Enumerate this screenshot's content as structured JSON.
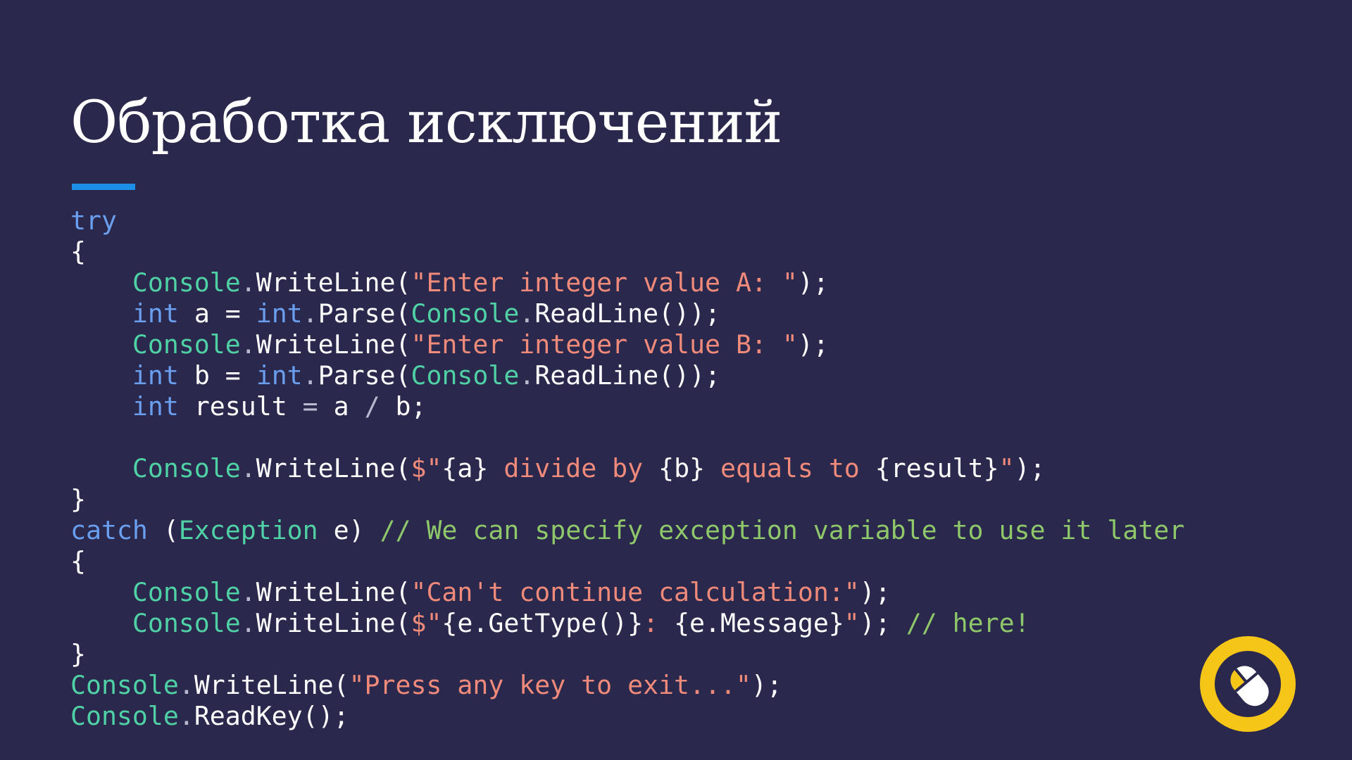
{
  "slide": {
    "title": "Обработка исключений"
  },
  "code": {
    "lines": [
      [
        {
          "t": "try",
          "c": "kw"
        }
      ],
      [
        {
          "t": "{",
          "c": "pl"
        }
      ],
      [
        {
          "t": "    ",
          "c": "pl"
        },
        {
          "t": "Console",
          "c": "ty"
        },
        {
          "t": ".",
          "c": "dim"
        },
        {
          "t": "WriteLine(",
          "c": "pl"
        },
        {
          "t": "\"Enter integer value A: \"",
          "c": "str"
        },
        {
          "t": ");",
          "c": "pl"
        }
      ],
      [
        {
          "t": "    ",
          "c": "pl"
        },
        {
          "t": "int",
          "c": "kw"
        },
        {
          "t": " a = ",
          "c": "pl"
        },
        {
          "t": "int",
          "c": "kw"
        },
        {
          "t": ".",
          "c": "dim"
        },
        {
          "t": "Parse(",
          "c": "pl"
        },
        {
          "t": "Console",
          "c": "ty"
        },
        {
          "t": ".",
          "c": "dim"
        },
        {
          "t": "ReadLine());",
          "c": "pl"
        }
      ],
      [
        {
          "t": "    ",
          "c": "pl"
        },
        {
          "t": "Console",
          "c": "ty"
        },
        {
          "t": ".",
          "c": "dim"
        },
        {
          "t": "WriteLine(",
          "c": "pl"
        },
        {
          "t": "\"Enter integer value B: \"",
          "c": "str"
        },
        {
          "t": ");",
          "c": "pl"
        }
      ],
      [
        {
          "t": "    ",
          "c": "pl"
        },
        {
          "t": "int",
          "c": "kw"
        },
        {
          "t": " b = ",
          "c": "pl"
        },
        {
          "t": "int",
          "c": "kw"
        },
        {
          "t": ".",
          "c": "dim"
        },
        {
          "t": "Parse(",
          "c": "pl"
        },
        {
          "t": "Console",
          "c": "ty"
        },
        {
          "t": ".",
          "c": "dim"
        },
        {
          "t": "ReadLine());",
          "c": "pl"
        }
      ],
      [
        {
          "t": "    ",
          "c": "pl"
        },
        {
          "t": "int",
          "c": "kw"
        },
        {
          "t": " result ",
          "c": "pl"
        },
        {
          "t": "=",
          "c": "dim"
        },
        {
          "t": " a ",
          "c": "pl"
        },
        {
          "t": "/",
          "c": "dim"
        },
        {
          "t": " b;",
          "c": "pl"
        }
      ],
      [
        {
          "t": "",
          "c": "pl"
        }
      ],
      [
        {
          "t": "    ",
          "c": "pl"
        },
        {
          "t": "Console",
          "c": "ty"
        },
        {
          "t": ".",
          "c": "dim"
        },
        {
          "t": "WriteLine(",
          "c": "pl"
        },
        {
          "t": "$\"",
          "c": "str"
        },
        {
          "t": "{a}",
          "c": "pl"
        },
        {
          "t": " divide by ",
          "c": "str"
        },
        {
          "t": "{b}",
          "c": "pl"
        },
        {
          "t": " equals to ",
          "c": "str"
        },
        {
          "t": "{result}",
          "c": "pl"
        },
        {
          "t": "\"",
          "c": "str"
        },
        {
          "t": ");",
          "c": "pl"
        }
      ],
      [
        {
          "t": "}",
          "c": "pl"
        }
      ],
      [
        {
          "t": "catch",
          "c": "kw"
        },
        {
          "t": " (",
          "c": "pl"
        },
        {
          "t": "Exception",
          "c": "ty"
        },
        {
          "t": " e) ",
          "c": "pl"
        },
        {
          "t": "// We can specify exception variable to use it later",
          "c": "cm"
        }
      ],
      [
        {
          "t": "{",
          "c": "pl"
        }
      ],
      [
        {
          "t": "    ",
          "c": "pl"
        },
        {
          "t": "Console",
          "c": "ty"
        },
        {
          "t": ".",
          "c": "dim"
        },
        {
          "t": "WriteLine(",
          "c": "pl"
        },
        {
          "t": "\"Can't continue calculation:\"",
          "c": "str"
        },
        {
          "t": ");",
          "c": "pl"
        }
      ],
      [
        {
          "t": "    ",
          "c": "pl"
        },
        {
          "t": "Console",
          "c": "ty"
        },
        {
          "t": ".",
          "c": "dim"
        },
        {
          "t": "WriteLine(",
          "c": "pl"
        },
        {
          "t": "$\"",
          "c": "str"
        },
        {
          "t": "{e.GetType()}",
          "c": "pl"
        },
        {
          "t": ": ",
          "c": "str"
        },
        {
          "t": "{e.Message}",
          "c": "pl"
        },
        {
          "t": "\"",
          "c": "str"
        },
        {
          "t": "); ",
          "c": "pl"
        },
        {
          "t": "// here!",
          "c": "cm"
        }
      ],
      [
        {
          "t": "}",
          "c": "pl"
        }
      ],
      [
        {
          "t": "Console",
          "c": "ty"
        },
        {
          "t": ".",
          "c": "dim"
        },
        {
          "t": "WriteLine(",
          "c": "pl"
        },
        {
          "t": "\"Press any key to exit...\"",
          "c": "str"
        },
        {
          "t": ");",
          "c": "pl"
        }
      ],
      [
        {
          "t": "Console",
          "c": "ty"
        },
        {
          "t": ".",
          "c": "dim"
        },
        {
          "t": "ReadKey();",
          "c": "pl"
        }
      ]
    ]
  },
  "logo": {
    "icon": "mouse-cursor-icon",
    "ring_color": "#f5c518",
    "inner_color": "#2a284c"
  },
  "colors": {
    "background": "#2a284c",
    "accent_underline": "#1e8fe6",
    "keyword": "#6a9ff0",
    "type": "#4fd1a5",
    "string": "#f08a7a",
    "comment": "#8fc86a"
  }
}
